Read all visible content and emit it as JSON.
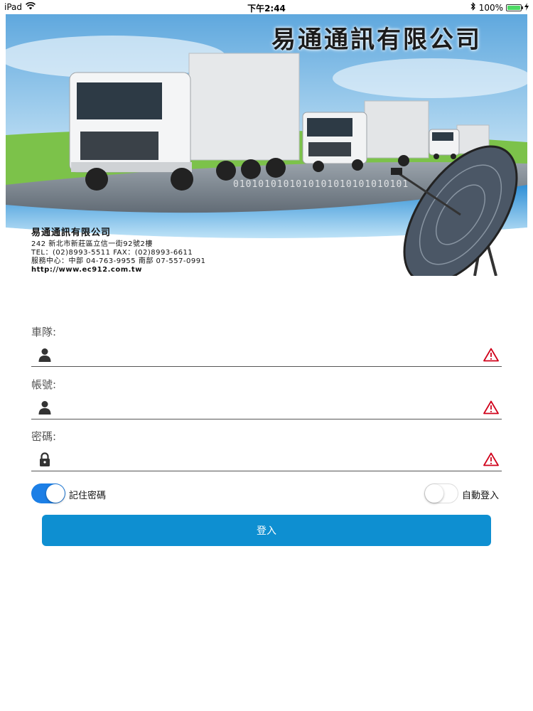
{
  "status_bar": {
    "device": "iPad",
    "time": "下午2:44",
    "battery_text": "100%",
    "battery_level": 1.0,
    "icons": [
      "wifi-icon",
      "bluetooth-icon",
      "battery-icon",
      "charging-icon"
    ]
  },
  "banner": {
    "title": "易通通訊有限公司",
    "binary_text": "0101010101010101010101010101",
    "company_name": "易通通訊有限公司",
    "address": "242 新北市新莊區立信一街92號2樓",
    "phone_fax": "TEL：(02)8993-5511   FAX：(02)8993-6611",
    "service": "服務中心：中部 04-763-9955   南部 07-557-0991",
    "website": "http://www.ec912.com.tw"
  },
  "form": {
    "fleet": {
      "label": "車隊:",
      "value": "",
      "icon": "user-icon",
      "status_icon": "warning-icon"
    },
    "account": {
      "label": "帳號:",
      "value": "",
      "icon": "user-icon",
      "status_icon": "warning-icon"
    },
    "password": {
      "label": "密碼:",
      "value": "",
      "icon": "lock-icon",
      "status_icon": "warning-icon"
    }
  },
  "options": {
    "remember_password": {
      "label": "記住密碼",
      "on": true
    },
    "auto_login": {
      "label": "自動登入",
      "on": false
    }
  },
  "login_button": {
    "label": "登入"
  },
  "colors": {
    "accent": "#1c7fe6",
    "button": "#0e8fd1",
    "warning": "#d0021b"
  }
}
